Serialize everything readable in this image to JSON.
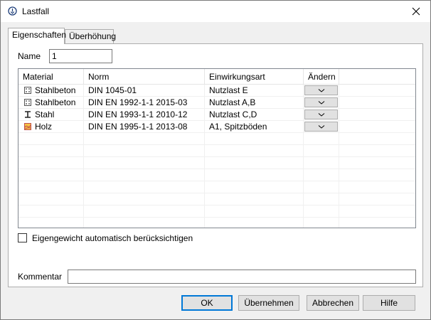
{
  "window": {
    "title": "Lastfall"
  },
  "tabs": [
    {
      "label": "Eigenschaften"
    },
    {
      "label": "Überhöhung"
    }
  ],
  "name_field": {
    "label": "Name",
    "value": "1"
  },
  "table": {
    "headers": [
      "Material",
      "Norm",
      "Einwirkungsart",
      "Ändern"
    ],
    "rows": [
      {
        "material": "Stahlbeton",
        "icon": "concrete-icon",
        "norm": "DIN 1045-01",
        "einwirkungsart": "Nutzlast E"
      },
      {
        "material": "Stahlbeton",
        "icon": "concrete-icon",
        "norm": "DIN EN 1992-1-1 2015-03",
        "einwirkungsart": "Nutzlast A,B"
      },
      {
        "material": "Stahl",
        "icon": "steel-beam-icon",
        "norm": "DIN EN 1993-1-1 2010-12",
        "einwirkungsart": "Nutzlast C,D"
      },
      {
        "material": "Holz",
        "icon": "wood-icon",
        "norm": "DIN EN 1995-1-1 2013-08",
        "einwirkungsart": "A1, Spitzböden"
      }
    ]
  },
  "checkbox": {
    "label": "Eigengewicht automatisch berücksichtigen",
    "checked": false
  },
  "comment": {
    "label": "Kommentar",
    "value": ""
  },
  "buttons": {
    "ok": "OK",
    "apply": "Übernehmen",
    "cancel": "Abbrechen",
    "help": "Hilfe"
  },
  "colors": {
    "accent": "#0078d7",
    "wood_icon": "#c0504d"
  }
}
